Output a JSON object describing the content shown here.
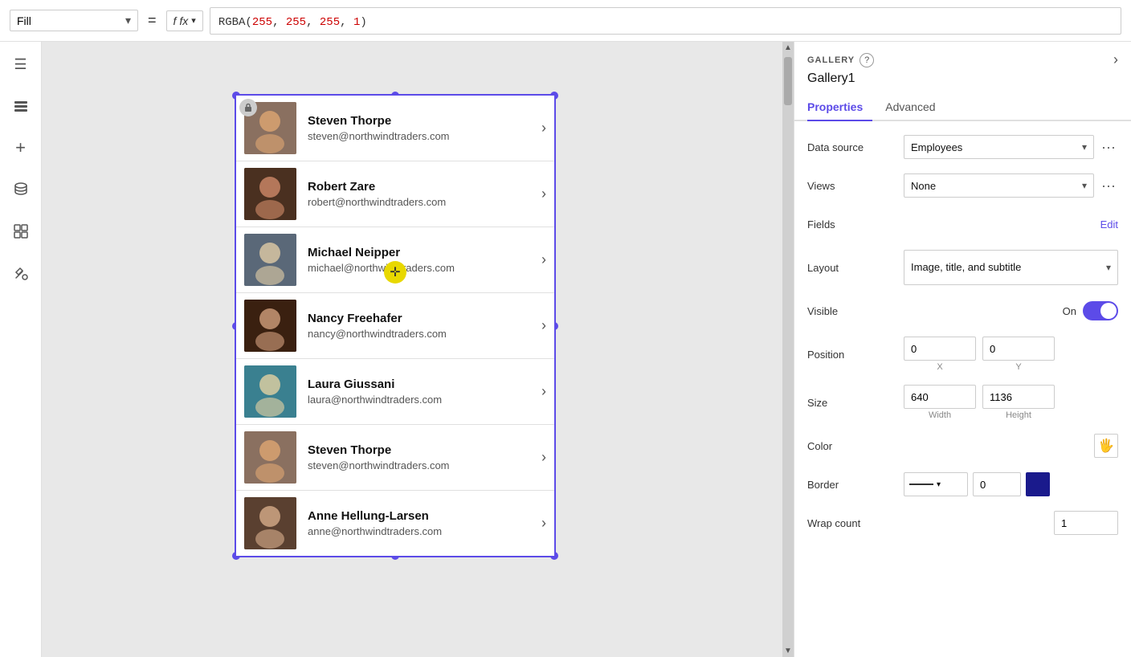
{
  "toolbar": {
    "fill_label": "Fill",
    "equals": "=",
    "fx_label": "fx",
    "formula_value": "RGBA(255, 255, 255, 1)"
  },
  "sidebar": {
    "icons": [
      {
        "name": "hamburger-icon",
        "symbol": "☰"
      },
      {
        "name": "layers-icon",
        "symbol": "◧"
      },
      {
        "name": "add-icon",
        "symbol": "+"
      },
      {
        "name": "database-icon",
        "symbol": "⬡"
      },
      {
        "name": "components-icon",
        "symbol": "⊞"
      },
      {
        "name": "tools-icon",
        "symbol": "✂"
      }
    ]
  },
  "gallery": {
    "items": [
      {
        "name": "Steven Thorpe",
        "email": "steven@northwindtraders.com",
        "avatar_class": "avatar-1"
      },
      {
        "name": "Robert Zare",
        "email": "robert@northwindtraders.com",
        "avatar_class": "avatar-2"
      },
      {
        "name": "Michael Neipper",
        "email": "michael@northwindtraders.com",
        "avatar_class": "avatar-3"
      },
      {
        "name": "Nancy Freehafer",
        "email": "nancy@northwindtraders.com",
        "avatar_class": "avatar-4"
      },
      {
        "name": "Laura Giussani",
        "email": "laura@northwindtraders.com",
        "avatar_class": "avatar-5"
      },
      {
        "name": "Steven Thorpe",
        "email": "steven@northwindtraders.com",
        "avatar_class": "avatar-6"
      },
      {
        "name": "Anne Hellung-Larsen",
        "email": "anne@northwindtraders.com",
        "avatar_class": "avatar-7"
      }
    ]
  },
  "right_panel": {
    "section_label": "GALLERY",
    "help_tooltip": "?",
    "gallery_name": "Gallery1",
    "tabs": [
      {
        "id": "properties",
        "label": "Properties",
        "active": true
      },
      {
        "id": "advanced",
        "label": "Advanced",
        "active": false
      }
    ],
    "properties": {
      "data_source": {
        "label": "Data source",
        "value": "Employees"
      },
      "views": {
        "label": "Views",
        "value": "None"
      },
      "fields": {
        "label": "Fields",
        "edit_label": "Edit"
      },
      "layout": {
        "label": "Layout",
        "value": "Image, title, and subtitle"
      },
      "visible": {
        "label": "Visible",
        "toggle_label": "On",
        "value": true
      },
      "position": {
        "label": "Position",
        "x": "0",
        "y": "0",
        "x_label": "X",
        "y_label": "Y"
      },
      "size": {
        "label": "Size",
        "width": "640",
        "height": "1136",
        "width_label": "Width",
        "height_label": "Height"
      },
      "color": {
        "label": "Color",
        "icon": "🖐"
      },
      "border": {
        "label": "Border",
        "style": "—",
        "thickness": "0",
        "color": "#1a1a8c"
      },
      "wrap_count": {
        "label": "Wrap count",
        "value": "1"
      }
    }
  }
}
